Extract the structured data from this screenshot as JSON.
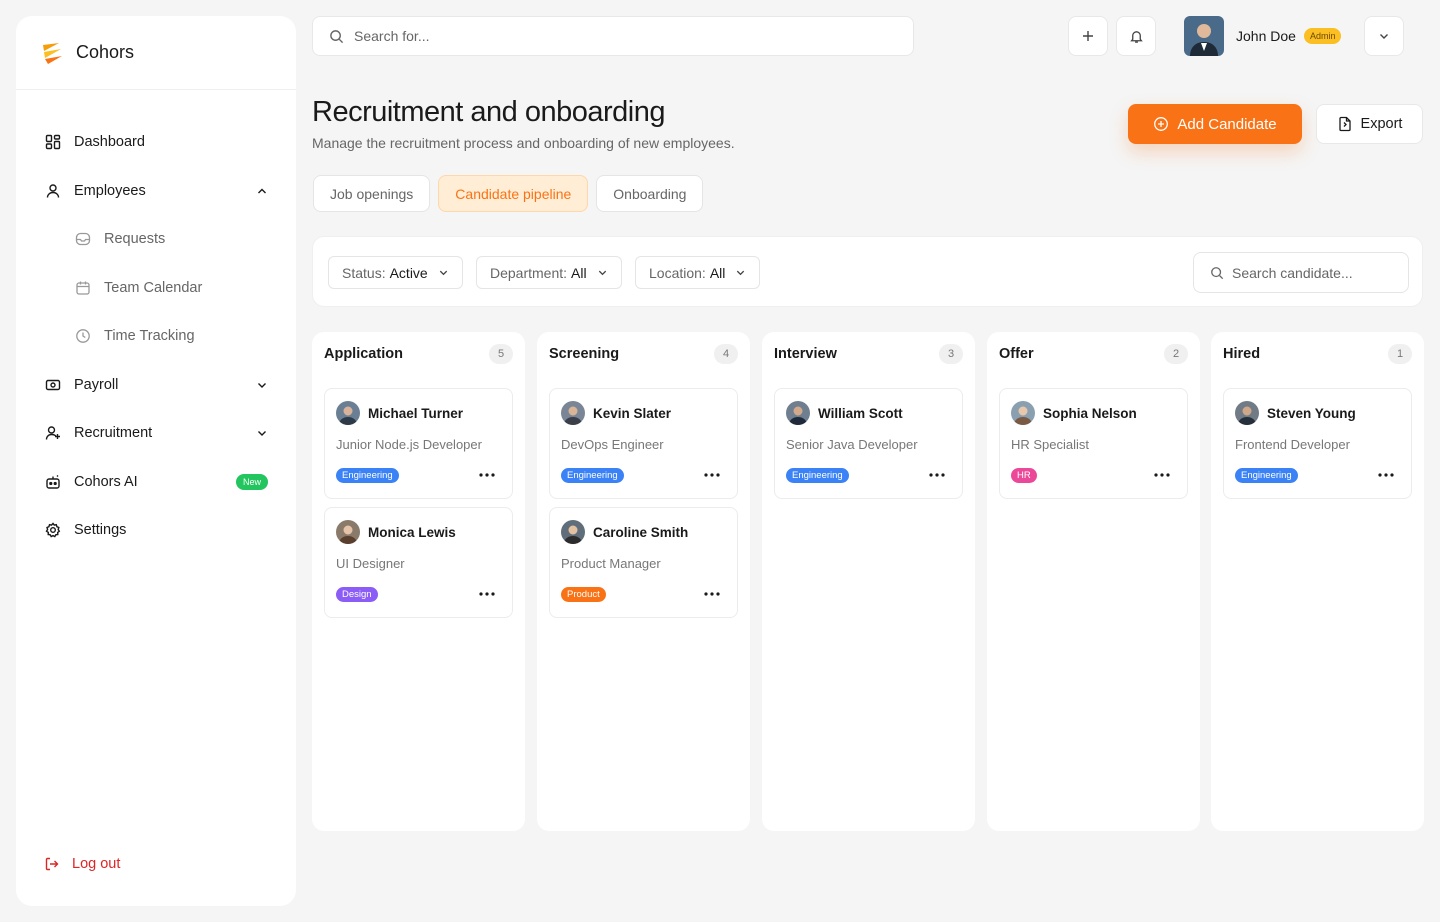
{
  "brand": {
    "name": "Cohors"
  },
  "nav": {
    "dashboard": "Dashboard",
    "employees": "Employees",
    "requests": "Requests",
    "team_calendar": "Team Calendar",
    "time_tracking": "Time Tracking",
    "payroll": "Payroll",
    "recruitment": "Recruitment",
    "cohors_ai": "Cohors AI",
    "new_badge": "New",
    "settings": "Settings",
    "logout": "Log out"
  },
  "topbar": {
    "search_placeholder": "Search for...",
    "user_name": "John Doe",
    "user_role": "Admin"
  },
  "header": {
    "title": "Recruitment and onboarding",
    "subtitle": "Manage the recruitment process and onboarding of new employees.",
    "add_label": "Add Candidate",
    "export_label": "Export"
  },
  "tabs": [
    "Job openings",
    "Candidate pipeline",
    "Onboarding"
  ],
  "filters": {
    "status_label": "Status:",
    "status_value": "Active",
    "department_label": "Department:",
    "department_value": "All",
    "location_label": "Location:",
    "location_value": "All",
    "search_placeholder": "Search candidate..."
  },
  "colors": {
    "accent": "#f97316",
    "engineering": "#3b82f6",
    "design": "#8b5cf6",
    "product": "#f97316",
    "hr": "#ec4899"
  },
  "columns": [
    {
      "title": "Application",
      "count": "5",
      "cards": [
        {
          "name": "Michael Turner",
          "role": "Junior Node.js Developer",
          "tag": "Engineering"
        },
        {
          "name": "Monica Lewis",
          "role": "UI Designer",
          "tag": "Design"
        }
      ]
    },
    {
      "title": "Screening",
      "count": "4",
      "cards": [
        {
          "name": "Kevin Slater",
          "role": "DevOps Engineer",
          "tag": "Engineering"
        },
        {
          "name": "Caroline Smith",
          "role": "Product Manager",
          "tag": "Product"
        }
      ]
    },
    {
      "title": "Interview",
      "count": "3",
      "cards": [
        {
          "name": "William Scott",
          "role": "Senior Java Developer",
          "tag": "Engineering"
        }
      ]
    },
    {
      "title": "Offer",
      "count": "2",
      "cards": [
        {
          "name": "Sophia Nelson",
          "role": "HR Specialist",
          "tag": "HR"
        }
      ]
    },
    {
      "title": "Hired",
      "count": "1",
      "cards": [
        {
          "name": "Steven Young",
          "role": "Frontend Developer",
          "tag": "Engineering"
        }
      ]
    }
  ]
}
